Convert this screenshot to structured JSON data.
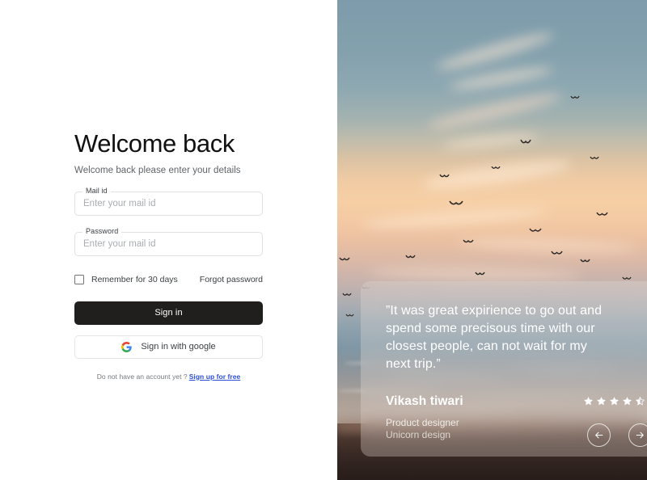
{
  "left": {
    "title": "Welcome back",
    "subtitle": "Welcome back please enter your details",
    "fields": [
      {
        "label": "Mail id",
        "placeholder": "Enter your mail id",
        "value": ""
      },
      {
        "label": "Password",
        "placeholder": "Enter your mail id",
        "value": ""
      }
    ],
    "remember_label": "Remember for 30 days",
    "forgot_label": "Forgot password",
    "signin_label": "Sign in",
    "google_label": "Sign in with google",
    "signup_prompt": "Do not have an account yet ?",
    "signup_link": "Sign up for free"
  },
  "testimonial": {
    "quote": "”It was great expirience to go out and spend some precisous time with our closest people, can not wait for my next trip.”",
    "name": "Vikash tiwari",
    "role": "Product designer",
    "company": "Unicorn design",
    "rating": 4.5,
    "stars_total": 5,
    "prev_label": "Previous testimonial",
    "next_label": "Next testimonial"
  },
  "colors": {
    "primary_button": "#211f1e",
    "link": "#2a4fd6",
    "field_border": "#dfe1e4",
    "muted_text": "#5f6368",
    "sky_top": "#7d9bab",
    "sky_sunset": "#f6cfa5",
    "rocks": "#2e221e",
    "card_overlay": "rgba(236,226,218,0.30)"
  },
  "icons": {
    "google": "google-g-logo",
    "checkbox": "checkbox-unchecked",
    "star": "star-filled",
    "star_half": "star-half",
    "arrow_left": "arrow-left",
    "arrow_right": "arrow-right"
  }
}
